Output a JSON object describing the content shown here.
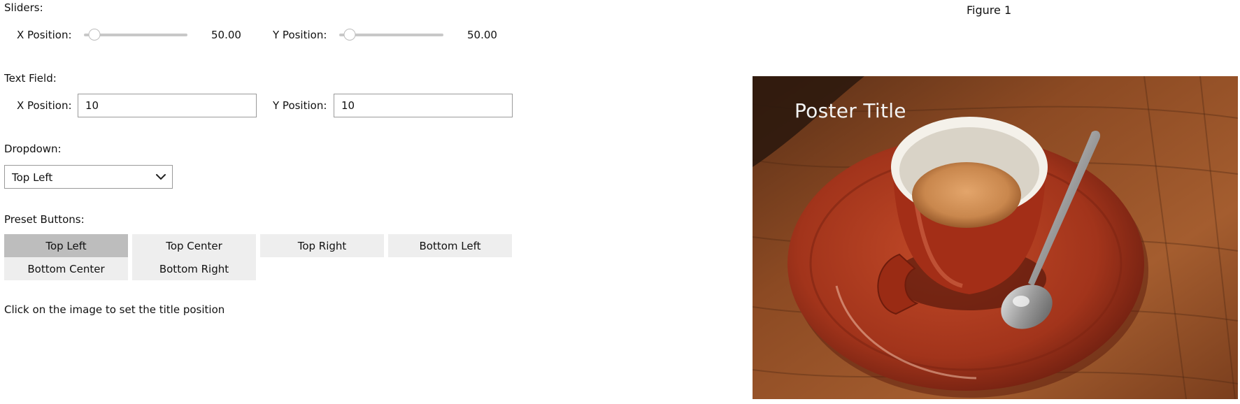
{
  "sliders": {
    "section_label": "Sliders:",
    "x": {
      "label": "X Position:",
      "value": 50.0,
      "value_text": "50.00",
      "min": 0,
      "max": 1000
    },
    "y": {
      "label": "Y Position:",
      "value": 50.0,
      "value_text": "50.00",
      "min": 0,
      "max": 1000
    }
  },
  "text_field": {
    "section_label": "Text Field:",
    "x": {
      "label": "X Position:",
      "value": "10"
    },
    "y": {
      "label": "Y Position:",
      "value": "10"
    }
  },
  "dropdown": {
    "section_label": "Dropdown:",
    "selected": "Top Left"
  },
  "presets": {
    "section_label": "Preset Buttons:",
    "buttons": [
      "Top Left",
      "Top Center",
      "Top Right",
      "Bottom Left",
      "Bottom Center",
      "Bottom Right"
    ],
    "active": "Top Left"
  },
  "hint": "Click on the image to set the title position",
  "figure": {
    "title": "Figure 1",
    "poster_title": "Poster Title",
    "image_subject": "espresso cup on red saucer with spoon on wooden table"
  },
  "colors": {
    "active_button": "#bdbdbd",
    "inactive_button": "#eeeeee",
    "cup_red": "#a8341c",
    "wood": "#8a4b22"
  }
}
